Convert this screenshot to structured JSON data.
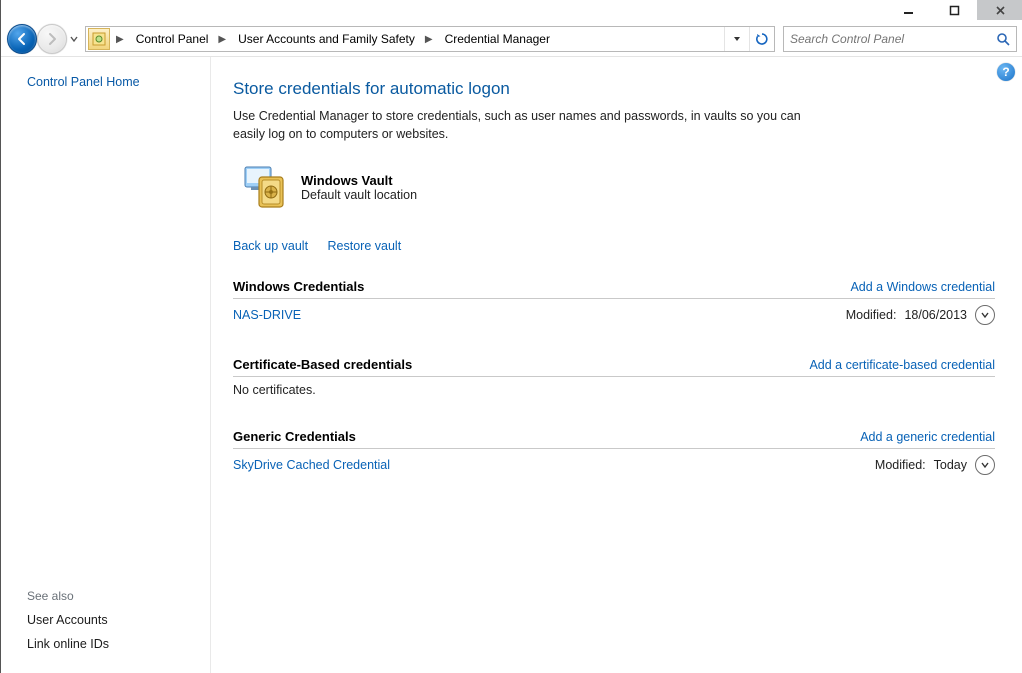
{
  "window": {
    "minimize": "—",
    "maximize": "❐",
    "close": "✕"
  },
  "breadcrumbs": {
    "root": "Control Panel",
    "group": "User Accounts and Family Safety",
    "page": "Credential Manager"
  },
  "search": {
    "placeholder": "Search Control Panel"
  },
  "sidebar": {
    "home": "Control Panel Home",
    "see_also_label": "See also",
    "user_accounts": "User Accounts",
    "link_online_ids": "Link online IDs"
  },
  "main": {
    "help_glyph": "?",
    "title": "Store credentials for automatic logon",
    "description": "Use Credential Manager to store credentials, such as user names and passwords, in vaults so you can easily log on to computers or websites.",
    "vault": {
      "title": "Windows Vault",
      "subtitle": "Default vault location"
    },
    "backup_link": "Back up vault",
    "restore_link": "Restore vault",
    "modified_label": "Modified:",
    "sections": {
      "windows": {
        "title": "Windows Credentials",
        "add_label": "Add a Windows credential",
        "items": [
          {
            "name": "NAS-DRIVE",
            "modified": "18/06/2013"
          }
        ]
      },
      "cert": {
        "title": "Certificate-Based credentials",
        "add_label": "Add a certificate-based credential",
        "empty_text": "No certificates."
      },
      "generic": {
        "title": "Generic Credentials",
        "add_label": "Add a generic credential",
        "items": [
          {
            "name": "SkyDrive Cached Credential",
            "modified": "Today"
          }
        ]
      }
    }
  }
}
